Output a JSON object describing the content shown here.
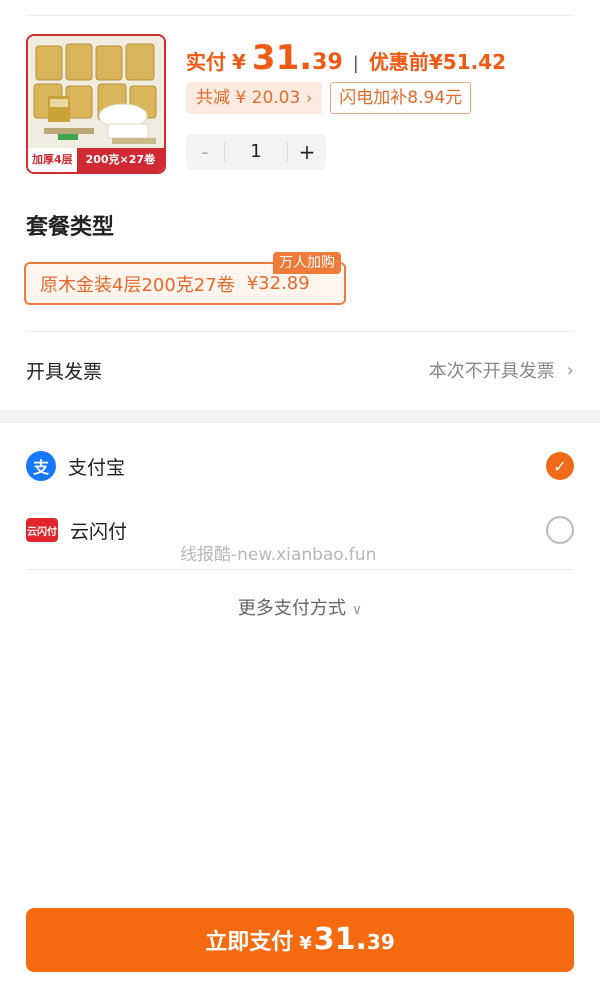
{
  "product": {
    "thumb_badge_left": "加厚4层",
    "thumb_badge_right": "200克×27卷",
    "actual_label": "实付",
    "currency": "¥",
    "actual_int": "31.",
    "actual_dec": "39",
    "separator": "|",
    "orig_label": "优惠前",
    "orig_price": "¥51.42",
    "reduce_tag": "共减 ¥ 20.03",
    "subsidy_tag": "闪电加补8.94元",
    "quantity": "1",
    "minus": "-",
    "plus": "+"
  },
  "package": {
    "title": "套餐类型",
    "option_label": "原木金装4层200克27卷",
    "option_price": "¥32.89",
    "badge": "万人加购"
  },
  "invoice": {
    "label": "开具发票",
    "value": "本次不开具发票"
  },
  "payment": {
    "methods": [
      {
        "name": "支付宝",
        "icon": "alipay-icon",
        "selected": true
      },
      {
        "name": "云闪付",
        "icon": "unionpay-icon",
        "selected": false
      }
    ],
    "unionpay_icon_text": "云闪付",
    "alipay_icon_text": "支",
    "more": "更多支付方式"
  },
  "watermark": "线报酷-new.xianbao.fun",
  "pay_button": {
    "label": "立即支付",
    "currency": "¥",
    "int": "31.",
    "dec": "39"
  },
  "colors": {
    "accent": "#f66a10",
    "alipay": "#1677ff",
    "unionpay": "#e0262b"
  }
}
